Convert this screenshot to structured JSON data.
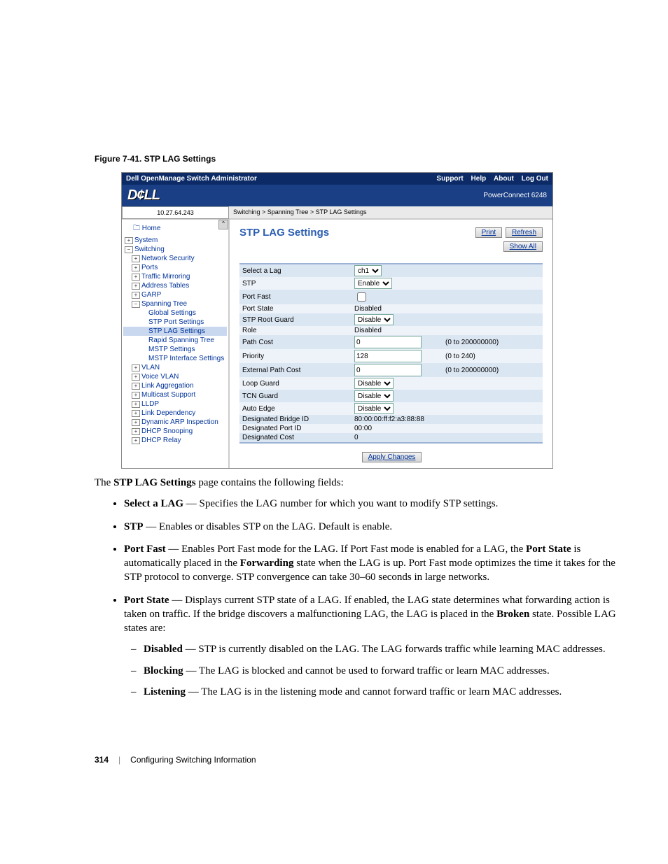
{
  "figure_caption": "Figure 7-41.    STP LAG Settings",
  "screenshot": {
    "title_bar_left": "Dell OpenManage Switch Administrator",
    "title_bar_right": [
      "Support",
      "Help",
      "About",
      "Log Out"
    ],
    "logo": "D¢LL",
    "product": "PowerConnect 6248",
    "ip": "10.27.64.243",
    "breadcrumb": "Switching > Spanning Tree > STP LAG Settings",
    "nav": [
      {
        "level": 1,
        "icon": "",
        "label": "Home",
        "kind": "home"
      },
      {
        "level": 1,
        "icon": "+",
        "label": "System"
      },
      {
        "level": 1,
        "icon": "−",
        "label": "Switching"
      },
      {
        "level": 2,
        "icon": "+",
        "label": "Network Security"
      },
      {
        "level": 2,
        "icon": "+",
        "label": "Ports"
      },
      {
        "level": 2,
        "icon": "+",
        "label": "Traffic Mirroring"
      },
      {
        "level": 2,
        "icon": "+",
        "label": "Address Tables"
      },
      {
        "level": 2,
        "icon": "+",
        "label": "GARP"
      },
      {
        "level": 2,
        "icon": "−",
        "label": "Spanning Tree"
      },
      {
        "level": 3,
        "icon": "",
        "label": "Global Settings"
      },
      {
        "level": 3,
        "icon": "",
        "label": "STP Port Settings"
      },
      {
        "level": 3,
        "icon": "",
        "label": "STP LAG Settings",
        "selected": true
      },
      {
        "level": 3,
        "icon": "",
        "label": "Rapid Spanning Tree"
      },
      {
        "level": 3,
        "icon": "",
        "label": "MSTP Settings"
      },
      {
        "level": 3,
        "icon": "",
        "label": "MSTP Interface Settings"
      },
      {
        "level": 2,
        "icon": "+",
        "label": "VLAN"
      },
      {
        "level": 2,
        "icon": "+",
        "label": "Voice VLAN"
      },
      {
        "level": 2,
        "icon": "+",
        "label": "Link Aggregation"
      },
      {
        "level": 2,
        "icon": "+",
        "label": "Multicast Support"
      },
      {
        "level": 2,
        "icon": "+",
        "label": "LLDP"
      },
      {
        "level": 2,
        "icon": "+",
        "label": "Link Dependency"
      },
      {
        "level": 2,
        "icon": "+",
        "label": "Dynamic ARP Inspection"
      },
      {
        "level": 2,
        "icon": "+",
        "label": "DHCP Snooping"
      },
      {
        "level": 2,
        "icon": "+",
        "label": "DHCP Relay"
      }
    ],
    "heading": "STP LAG Settings",
    "buttons": {
      "print": "Print",
      "refresh": "Refresh",
      "show_all": "Show All",
      "apply": "Apply Changes"
    },
    "form": [
      {
        "label": "Select a Lag",
        "type": "select",
        "value": "ch1",
        "hint": ""
      },
      {
        "label": "STP",
        "type": "select",
        "value": "Enable",
        "hint": ""
      },
      {
        "label": "Port Fast",
        "type": "checkbox",
        "value": "",
        "hint": ""
      },
      {
        "label": "Port State",
        "type": "text",
        "value": "Disabled",
        "hint": ""
      },
      {
        "label": "STP Root Guard",
        "type": "select",
        "value": "Disable",
        "hint": ""
      },
      {
        "label": "Role",
        "type": "text",
        "value": "Disabled",
        "hint": ""
      },
      {
        "label": "Path Cost",
        "type": "input",
        "value": "0",
        "hint": "(0 to 200000000)"
      },
      {
        "label": "Priority",
        "type": "input",
        "value": "128",
        "hint": "(0 to 240)"
      },
      {
        "label": "External Path Cost",
        "type": "input",
        "value": "0",
        "hint": "(0 to 200000000)"
      },
      {
        "label": "Loop Guard",
        "type": "select",
        "value": "Disable",
        "hint": ""
      },
      {
        "label": "TCN Guard",
        "type": "select",
        "value": "Disable",
        "hint": ""
      },
      {
        "label": "Auto Edge",
        "type": "select",
        "value": "Disable",
        "hint": ""
      },
      {
        "label": "Designated Bridge ID",
        "type": "text",
        "value": "80:00:00:ff:f2:a3:88:88",
        "hint": ""
      },
      {
        "label": "Designated Port ID",
        "type": "text",
        "value": "00:00",
        "hint": ""
      },
      {
        "label": "Designated Cost",
        "type": "text",
        "value": "0",
        "hint": ""
      }
    ]
  },
  "body": {
    "intro_pre": "The ",
    "intro_bold": "STP LAG Settings",
    "intro_post": " page contains the following fields:",
    "items": {
      "select_lag": {
        "term": "Select a LAG",
        "desc": " — Specifies the LAG number for which you want to modify STP settings."
      },
      "stp": {
        "term": "STP",
        "desc": " — Enables or disables STP on the LAG. Default is enable."
      },
      "port_fast": {
        "term": "Port Fast",
        "p1": " — Enables Port Fast mode for the LAG. If Port Fast mode is enabled for a LAG, the ",
        "b1": "Port State",
        "p2": " is automatically placed in the ",
        "b2": "Forwarding",
        "p3": " state when the LAG is up. Port Fast mode optimizes the time it takes for the STP protocol to converge. STP convergence can take 30–60 seconds in large networks."
      },
      "port_state": {
        "term": "Port State",
        "p1": " — Displays current STP state of a LAG. If enabled, the LAG state determines what forwarding action is taken on traffic. If the bridge discovers a malfunctioning LAG, the LAG is placed in the ",
        "b1": "Broken",
        "p2": " state. Possible LAG states are:",
        "sub": {
          "disabled": {
            "term": "Disabled",
            "desc": " — STP is currently disabled on the LAG. The LAG forwards traffic while learning MAC addresses."
          },
          "blocking": {
            "term": "Blocking",
            "desc": " — The LAG is blocked and cannot be used to forward traffic or learn MAC addresses."
          },
          "listening": {
            "term": "Listening",
            "desc": " — The LAG is in the listening mode and cannot forward traffic or learn MAC addresses."
          }
        }
      }
    }
  },
  "footer": {
    "page": "314",
    "section": "Configuring Switching Information"
  }
}
